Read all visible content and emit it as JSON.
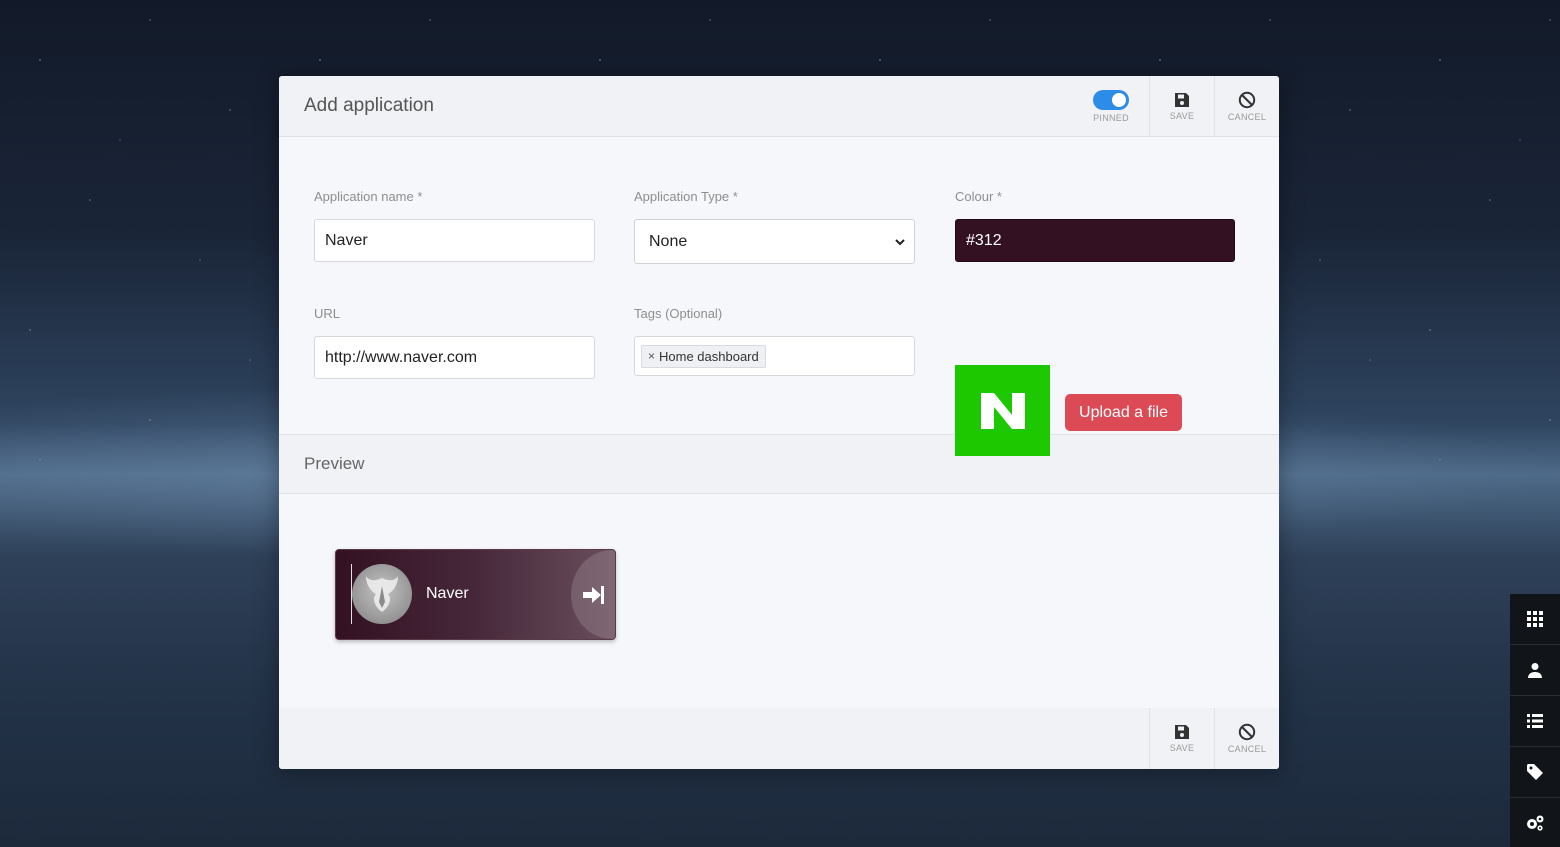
{
  "modal": {
    "title": "Add application",
    "header_actions": {
      "pinned_label": "PINNED",
      "pinned_on": true,
      "save_label": "SAVE",
      "cancel_label": "CANCEL"
    },
    "form": {
      "app_name": {
        "label": "Application name *",
        "value": "Naver"
      },
      "app_type": {
        "label": "Application Type *",
        "value": "None"
      },
      "colour": {
        "label": "Colour *",
        "value": "#312",
        "swatch": "#331122"
      },
      "url": {
        "label": "URL",
        "value": "http://www.naver.com"
      },
      "tags": {
        "label": "Tags (Optional)",
        "items": [
          "Home dashboard"
        ],
        "remove_glyph": "×"
      },
      "logo": {
        "letter": "N",
        "background": "#1ec800"
      },
      "upload_label": "Upload a file"
    },
    "preview": {
      "title": "Preview",
      "tile_name": "Naver"
    },
    "footer_actions": {
      "save_label": "SAVE",
      "cancel_label": "CANCEL"
    }
  },
  "sidebar": {
    "items": [
      {
        "icon": "apps-grid-icon"
      },
      {
        "icon": "user-icon"
      },
      {
        "icon": "list-icon"
      },
      {
        "icon": "tag-icon"
      },
      {
        "icon": "settings-gears-icon"
      }
    ]
  },
  "colors": {
    "accent_toggle": "#2d8ce8",
    "upload_button": "#dc4b55",
    "tile_color": "#331122"
  }
}
